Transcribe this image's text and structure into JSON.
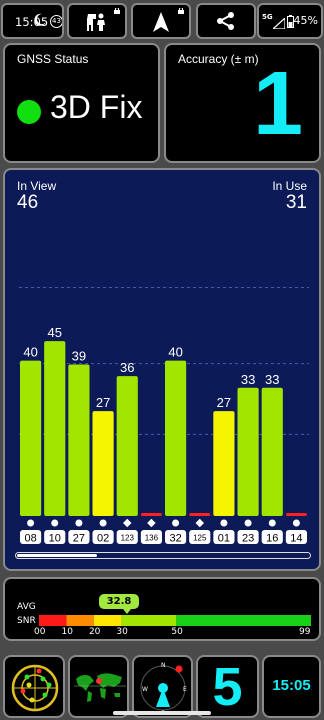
{
  "status_bar": {
    "time": "15:05",
    "notification_count": "43",
    "network": "5G",
    "battery": "45%"
  },
  "toolbar": [
    {
      "name": "moon-icon"
    },
    {
      "name": "sky-view-icon"
    },
    {
      "name": "navigation-arrow-icon"
    },
    {
      "name": "share-icon"
    },
    {
      "name": "signal-battery-icon"
    }
  ],
  "gnss_status": {
    "label": "GNSS Status",
    "value": "3D Fix",
    "indicator_color": "#10e010"
  },
  "accuracy": {
    "label": "Accuracy (± m)",
    "value": "1",
    "color": "#14ecf6"
  },
  "satellites": {
    "in_view_label": "In View",
    "in_view": "46",
    "in_use_label": "In Use",
    "in_use": "31"
  },
  "chart_data": {
    "type": "bar",
    "ylim": [
      0,
      70
    ],
    "grid": true,
    "bars": [
      {
        "prn": "08",
        "snr": 40,
        "color": "#a2e600",
        "shape": "circle",
        "label": "40"
      },
      {
        "prn": "10",
        "snr": 45,
        "color": "#a2e600",
        "shape": "circle",
        "label": "45"
      },
      {
        "prn": "27",
        "snr": 39,
        "color": "#a2e600",
        "shape": "circle",
        "label": "39"
      },
      {
        "prn": "02",
        "snr": 27,
        "color": "#f5f500",
        "shape": "circle",
        "label": "27"
      },
      {
        "prn": "123",
        "snr": 36,
        "color": "#a2e600",
        "shape": "diamond",
        "label": "36"
      },
      {
        "prn": "136",
        "snr": 0,
        "color": "#ff2020",
        "shape": "diamond",
        "label": ""
      },
      {
        "prn": "32",
        "snr": 40,
        "color": "#a2e600",
        "shape": "circle",
        "label": "40"
      },
      {
        "prn": "125",
        "snr": 0,
        "color": "#ff2020",
        "shape": "diamond",
        "label": ""
      },
      {
        "prn": "01",
        "snr": 27,
        "color": "#f5f500",
        "shape": "circle",
        "label": "27"
      },
      {
        "prn": "23",
        "snr": 33,
        "color": "#a2e600",
        "shape": "circle",
        "label": "33"
      },
      {
        "prn": "16",
        "snr": 33,
        "color": "#a2e600",
        "shape": "circle",
        "label": "33"
      },
      {
        "prn": "14",
        "snr": 0,
        "color": "#ff2020",
        "shape": "circle",
        "label": ""
      }
    ]
  },
  "snr": {
    "avg_label": "AVG",
    "snr_label": "SNR",
    "avg_value": "32.8",
    "avg_numeric": 32.8,
    "scale_max": 99,
    "ticks": [
      "00",
      "10",
      "20",
      "30",
      "50",
      "99"
    ],
    "tick_values": [
      0,
      10,
      20,
      30,
      50,
      99
    ],
    "segments": [
      {
        "from": 0,
        "to": 10,
        "color": "#ff1a1a"
      },
      {
        "from": 10,
        "to": 20,
        "color": "#ff8c00"
      },
      {
        "from": 20,
        "to": 30,
        "color": "#ffe600"
      },
      {
        "from": 30,
        "to": 50,
        "color": "#a2e600"
      },
      {
        "from": 50,
        "to": 99,
        "color": "#18d018"
      }
    ]
  },
  "bottom_toolbar": {
    "radar": "radar-icon",
    "map": "world-map-icon",
    "compass": "compass-icon",
    "compass_north": "N",
    "compass_west": "W",
    "compass_east": "E",
    "compass_south": "S",
    "satellite_count": "5",
    "clock": "15:05"
  }
}
